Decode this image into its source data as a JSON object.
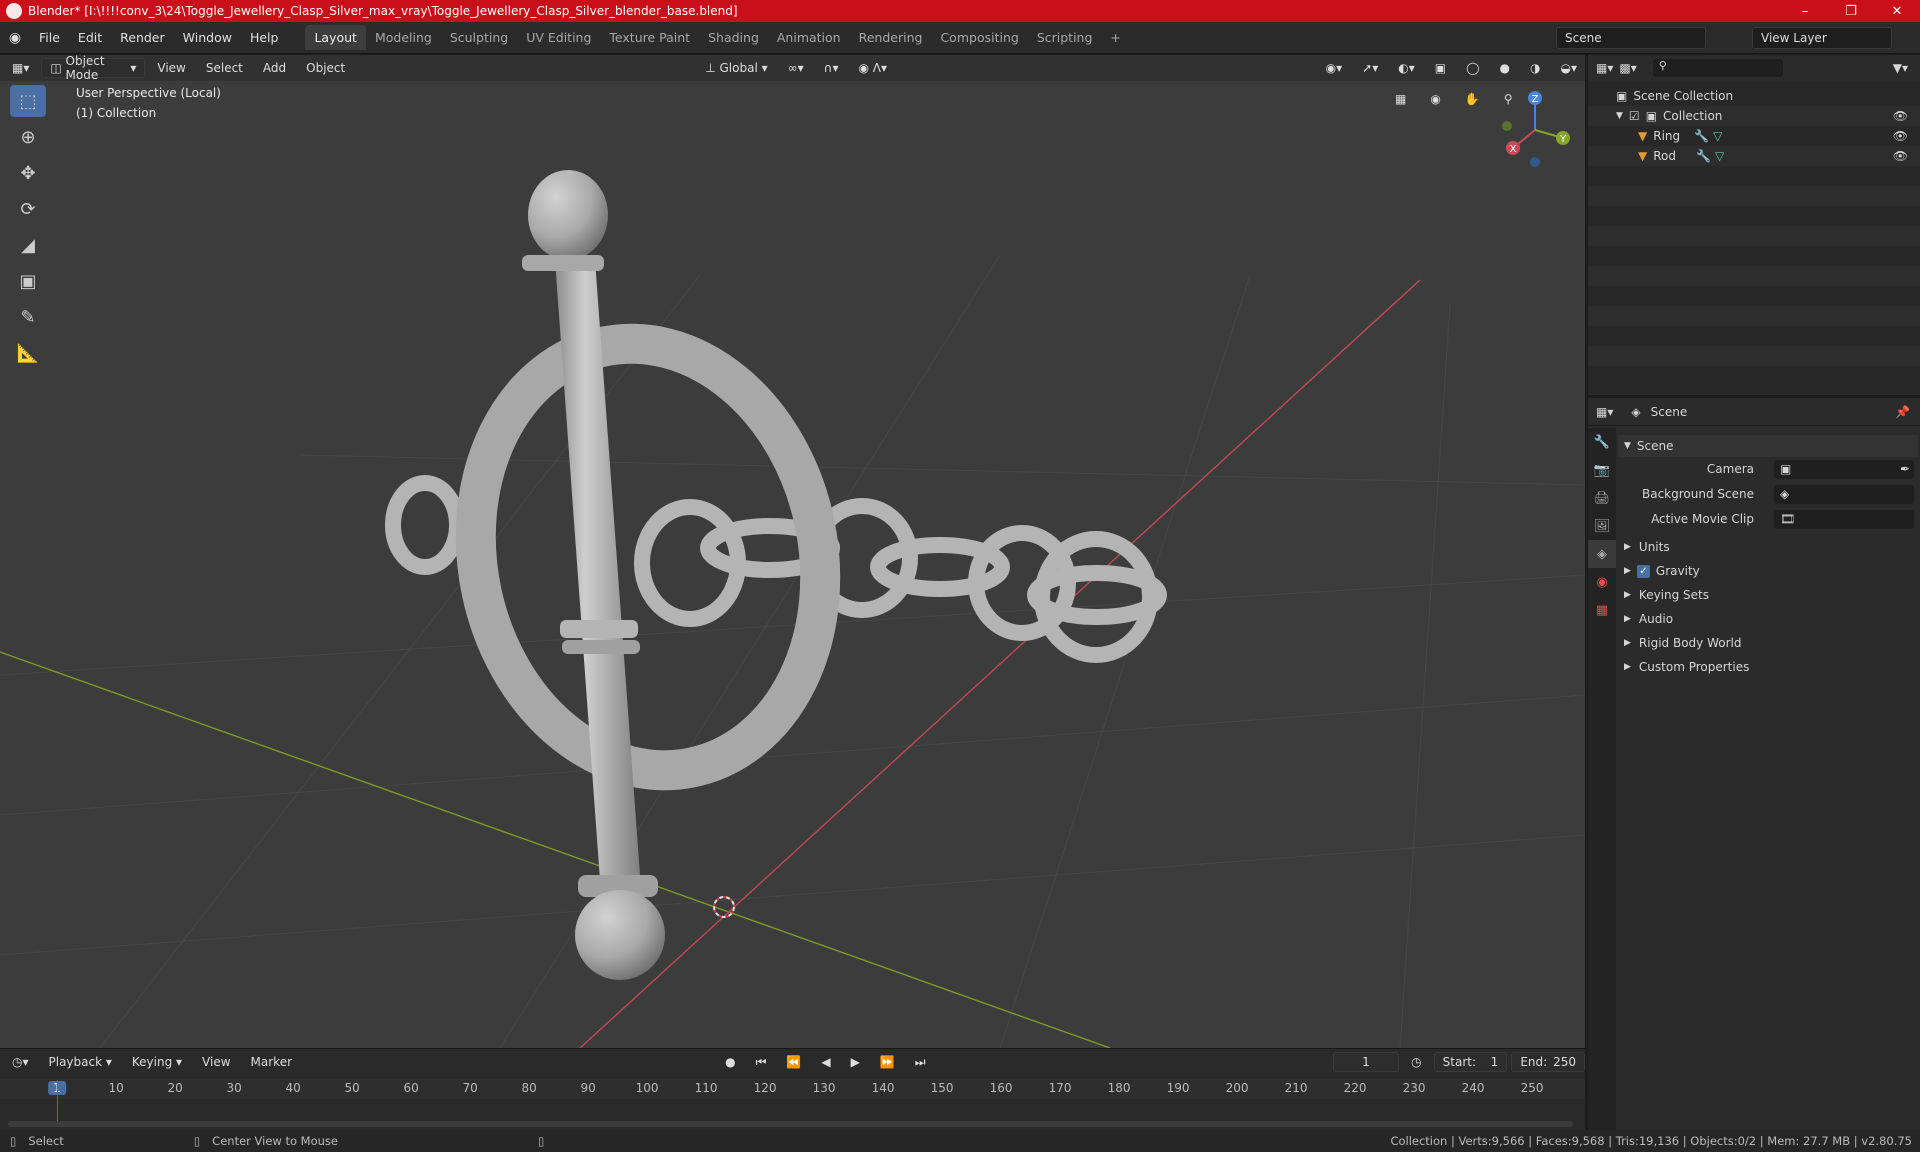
{
  "window": {
    "title": "Blender* [I:\\!!!!conv_3\\24\\Toggle_Jewellery_Clasp_Silver_max_vray\\Toggle_Jewellery_Clasp_Silver_blender_base.blend]"
  },
  "menu": [
    "File",
    "Edit",
    "Render",
    "Window",
    "Help"
  ],
  "workspaces": [
    "Layout",
    "Modeling",
    "Sculpting",
    "UV Editing",
    "Texture Paint",
    "Shading",
    "Animation",
    "Rendering",
    "Compositing",
    "Scripting"
  ],
  "active_workspace": "Layout",
  "scene_name": "Scene",
  "view_layer": "View Layer",
  "viewport": {
    "mode": "Object Mode",
    "menus": [
      "View",
      "Select",
      "Add",
      "Object"
    ],
    "orientation": "Global",
    "info_line1": "User Perspective (Local)",
    "info_line2": "(1) Collection",
    "gizmo": {
      "x": "X",
      "y": "Y",
      "z": "Z"
    }
  },
  "outliner": {
    "root": "Scene Collection",
    "collection": "Collection",
    "objects": [
      "Ring",
      "Rod"
    ],
    "search_placeholder": ""
  },
  "properties": {
    "header": "Scene",
    "panel": "Scene",
    "camera_label": "Camera",
    "bg_scene_label": "Background Scene",
    "movie_clip_label": "Active Movie Clip",
    "sections": [
      "Units",
      "Gravity",
      "Keying Sets",
      "Audio",
      "Rigid Body World",
      "Custom Properties"
    ],
    "gravity_checked": true
  },
  "timeline": {
    "menus": [
      "Playback",
      "Keying",
      "View",
      "Marker"
    ],
    "current_frame": "1",
    "start_label": "Start:",
    "start": "1",
    "end_label": "End:",
    "end": "250",
    "ruler": [
      "1",
      "10",
      "20",
      "30",
      "40",
      "50",
      "60",
      "70",
      "80",
      "90",
      "100",
      "110",
      "120",
      "130",
      "140",
      "150",
      "160",
      "170",
      "180",
      "190",
      "200",
      "210",
      "220",
      "230",
      "240",
      "250"
    ]
  },
  "status": {
    "left_action": "Select",
    "mid_action": "Center View to Mouse",
    "stats": "Collection | Verts:9,566 | Faces:9,568 | Tris:19,136 | Objects:0/2 | Mem: 27.7 MB | v2.80.75"
  },
  "colors": {
    "accent": "#4a6fa5",
    "titlebar": "#c9101a",
    "x_axis": "#c94a5a",
    "y_axis": "#87a52a",
    "z_axis": "#4a84d4"
  }
}
